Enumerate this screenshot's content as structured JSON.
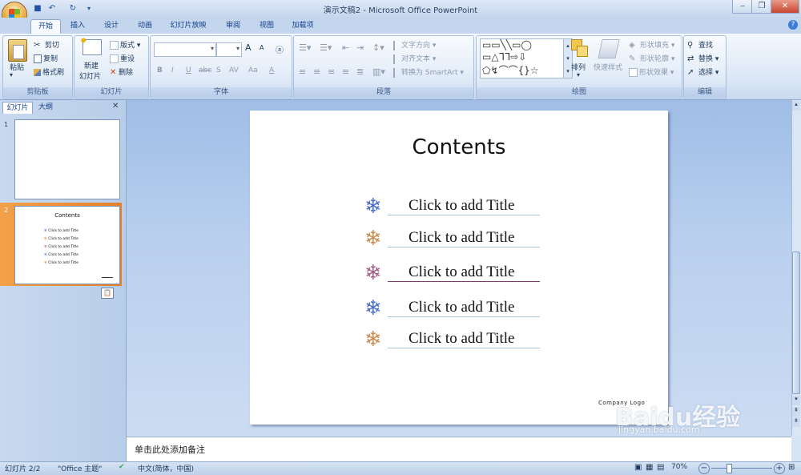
{
  "window": {
    "title": "演示文稿2 - Microsoft Office PowerPoint",
    "min": "‒",
    "max": "❐",
    "close": "✕"
  },
  "quick_access": {
    "save": "■",
    "undo": "↶",
    "redo": "↻"
  },
  "tabs": [
    {
      "label": "开始",
      "active": true
    },
    {
      "label": "插入"
    },
    {
      "label": "设计"
    },
    {
      "label": "动画"
    },
    {
      "label": "幻灯片放映"
    },
    {
      "label": "审阅"
    },
    {
      "label": "视图"
    },
    {
      "label": "加载项"
    }
  ],
  "help_icon": "?",
  "ribbon": {
    "clipboard": {
      "label": "剪贴板",
      "paste": "粘贴",
      "cut": "剪切",
      "copy": "复制",
      "format_painter": "格式刷"
    },
    "slides": {
      "label": "幻灯片",
      "new_slide_1": "新建",
      "new_slide_2": "幻灯片",
      "layout": "版式",
      "reset": "重设",
      "delete": "删除"
    },
    "font": {
      "label": "字体",
      "bold": "B",
      "italic": "I",
      "underline": "U",
      "strike": "abc",
      "shadow": "S",
      "spacing": "AV",
      "case": "Aa",
      "color": "A",
      "grow": "A",
      "shrink": "A",
      "clear": "ⓐ"
    },
    "paragraph": {
      "label": "段落",
      "text_direction": "文字方向",
      "align_text": "对齐文本",
      "smartart": "转换为 SmartArt"
    },
    "drawing": {
      "label": "绘图",
      "arrange": "排列",
      "quick_styles": "快速样式",
      "shape_fill": "形状填充",
      "shape_outline": "形状轮廓",
      "shape_effects": "形状效果"
    },
    "editing": {
      "label": "编辑",
      "find": "查找",
      "replace": "替换",
      "select": "选择"
    }
  },
  "panel": {
    "tab_slides": "幻灯片",
    "tab_outline": "大纲",
    "close": "✕",
    "thumbnails": [
      {
        "number": "1"
      },
      {
        "number": "2",
        "title": "Contents",
        "items": [
          "Click to add Title",
          "Click to add Title",
          "Click to add Title",
          "Click to add Title",
          "Click to add Title"
        ]
      }
    ]
  },
  "slide": {
    "title": "Contents",
    "items": [
      {
        "text": "Click to add Title",
        "color": "#4a6fcf",
        "line": "#a7c4d8"
      },
      {
        "text": "Click to add Title",
        "color": "#c98c52",
        "line": "#a7c4d8"
      },
      {
        "text": "Click to add Title",
        "color": "#a4608a",
        "line": "#7a3c6a"
      },
      {
        "text": "Click to add Title",
        "color": "#4a6fcf",
        "line": "#a7c4d8"
      },
      {
        "text": "Click to add Title",
        "color": "#c98c52",
        "line": "#a7c4d8"
      }
    ],
    "company_logo": "Company Logo"
  },
  "notes": {
    "placeholder": "单击此处添加备注"
  },
  "status": {
    "slide_count": "幻灯片 2/2",
    "theme": "\"Office 主题\"",
    "language": "中文(简体，中国)",
    "zoom": "70%"
  },
  "watermark": {
    "brand": "Baidu经验",
    "url": "jingyan.baidu.com"
  }
}
